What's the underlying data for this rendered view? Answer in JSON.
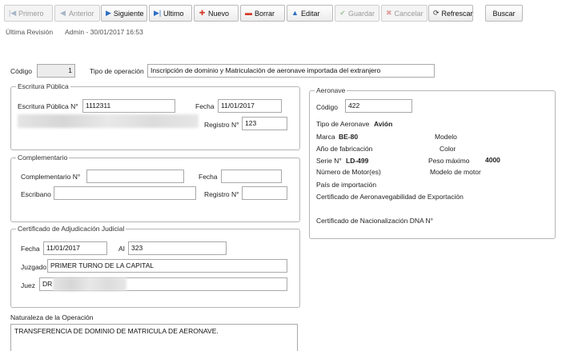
{
  "toolbar": {
    "primero": "Primero",
    "anterior": "Anterior",
    "siguiente": "Siguiente",
    "ultimo": "Ultimo",
    "nuevo": "Nuevo",
    "borrar": "Borrar",
    "editar": "Editar",
    "guardar": "Guardar",
    "cancelar": "Cancelar",
    "refrescar": "Refrescar",
    "buscar": "Buscar"
  },
  "meta": {
    "ultima_revision_label": "Última Revisión",
    "ultima_revision_value": "Admin - 30/01/2017 16:53"
  },
  "header": {
    "codigo_label": "Código",
    "codigo_value": "1",
    "tipo_operacion_label": "Tipo de operación",
    "tipo_operacion_value": "Inscripción de dominio y Matriculación de aeronave importada del extranjero"
  },
  "escritura": {
    "legend": "Escritura Pública",
    "numero_label": "Escritura Pública N°",
    "numero_value": "1112311",
    "fecha_label": "Fecha",
    "fecha_value": "11/01/2017",
    "registro_label": "Registro N°",
    "registro_value": "123"
  },
  "complementario": {
    "legend": "Complementario",
    "numero_label": "Complementario N°",
    "numero_value": "",
    "fecha_label": "Fecha",
    "fecha_value": "",
    "escribano_label": "Escribano",
    "escribano_value": "",
    "registro_label": "Registro N°",
    "registro_value": ""
  },
  "certificado": {
    "legend": "Certificado de Adjudicación Judicial",
    "fecha_label": "Fecha",
    "fecha_value": "11/01/2017",
    "ai_label": "AI",
    "ai_value": "323",
    "juzgado_label": "Juzgado",
    "juzgado_value": "PRIMER TURNO DE LA CAPITAL",
    "juez_label": "Juez",
    "juez_value": "DR"
  },
  "naturaleza": {
    "label": "Naturaleza de la Operación",
    "value": "TRANSFERENCIA DE DOMINIO DE MATRICULA DE AERONAVE."
  },
  "aeronave": {
    "legend": "Aeronave",
    "codigo_label": "Código",
    "codigo_value": "422",
    "tipo_label": "Tipo de Aeronave",
    "tipo_value": "Avión",
    "marca_label": "Marca",
    "marca_value": "BE-80",
    "modelo_label": "Modelo",
    "anio_label": "Año de fabricación",
    "color_label": "Color",
    "serie_label": "Serie N°",
    "serie_value": "LD-499",
    "peso_label": "Peso máximo",
    "peso_value": "4000",
    "motor_label": "Número de Motor(es)",
    "modelo_motor_label": "Modelo de motor",
    "pais_label": "País de importación",
    "cert_aero_label": "Certificado de Aeronavegabilidad de Exportación",
    "cert_nac_label": "Certificado de Nacionalización DNA N°"
  }
}
